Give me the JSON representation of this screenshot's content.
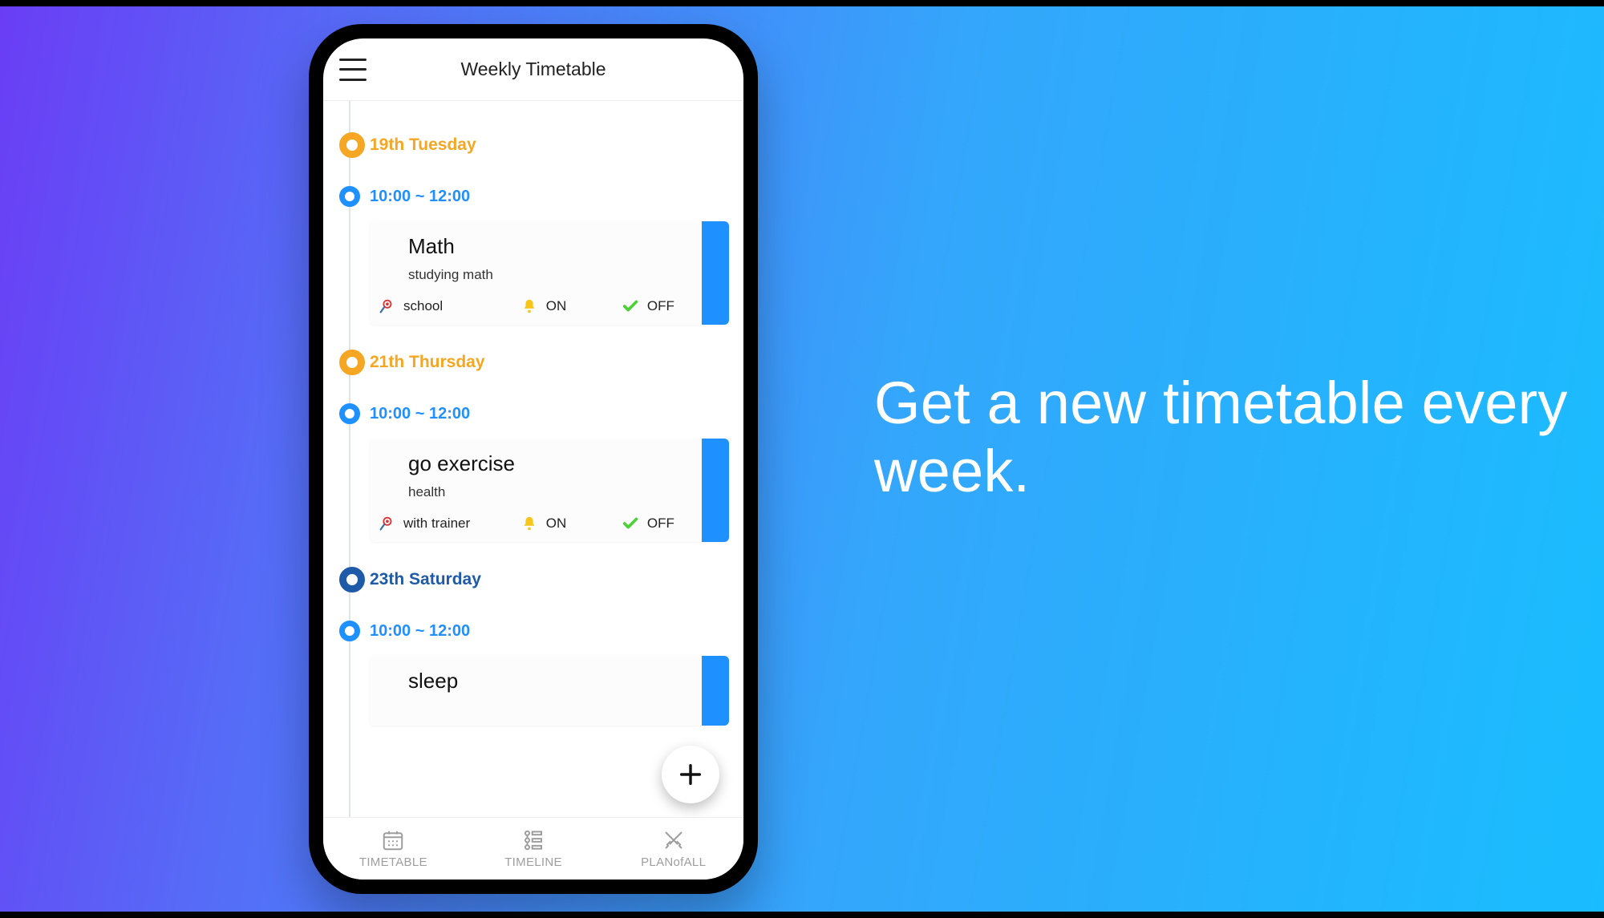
{
  "tagline": "Get a new timetable every week.",
  "header": {
    "title": "Weekly Timetable"
  },
  "days": [
    {
      "label": "19th Tuesday",
      "color": "orange",
      "slots": [
        {
          "time": "10:00 ~ 12:00",
          "event": {
            "title": "Math",
            "subtitle": "studying math",
            "location": "school",
            "alarm": "ON",
            "check": "OFF"
          }
        }
      ]
    },
    {
      "label": "21th Thursday",
      "color": "orange",
      "slots": [
        {
          "time": "10:00 ~ 12:00",
          "event": {
            "title": "go exercise",
            "subtitle": "health",
            "location": "with trainer",
            "alarm": "ON",
            "check": "OFF"
          }
        }
      ]
    },
    {
      "label": "23th Saturday",
      "color": "darkblue",
      "slots": [
        {
          "time": "10:00 ~ 12:00",
          "event": {
            "title": "sleep",
            "subtitle": "",
            "location": "",
            "alarm": "",
            "check": ""
          }
        }
      ]
    }
  ],
  "bottomNav": [
    {
      "label": "TIMETABLE"
    },
    {
      "label": "TIMELINE"
    },
    {
      "label": "PLANofALL"
    }
  ]
}
